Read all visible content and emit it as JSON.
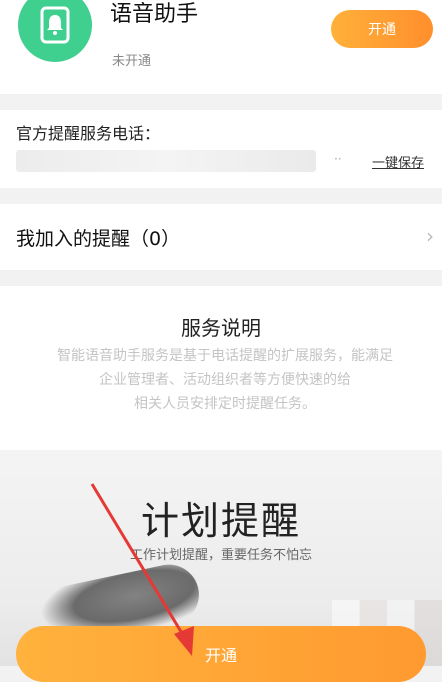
{
  "app": {
    "name": "语音助手",
    "status": "未开通",
    "open_label": "开通",
    "icon": "phone-bell-icon",
    "icon_color": "#3fcf8e"
  },
  "phone_section": {
    "label": "官方提醒服务电话：",
    "dots": "··",
    "save_label": "一键保存"
  },
  "joined_section": {
    "label": "我加入的提醒（0）",
    "chevron": "›"
  },
  "description": {
    "title": "服务说明",
    "body_lines": [
      "智能语音助手服务是基于电话提醒的扩展服务，能满足",
      "企业管理者、活动组织者等方便快速的给",
      "相关人员安排定时提醒任务。"
    ]
  },
  "promo": {
    "title": "计划提醒",
    "subtitle": "工作计划提醒，重要任务不怕忘"
  },
  "bottom_button": {
    "label": "开通"
  },
  "colors": {
    "accent": "#ff9a30",
    "arrow": "#e53935"
  }
}
